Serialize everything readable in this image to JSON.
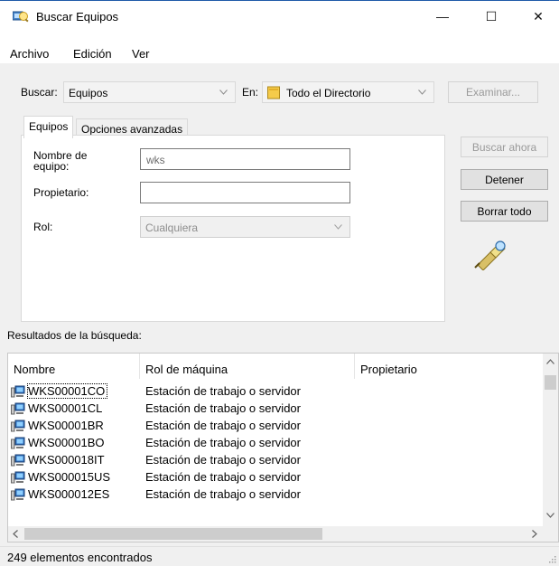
{
  "window": {
    "title": "Buscar Equipos",
    "minimize_glyph": "—",
    "maximize_glyph": "☐",
    "close_glyph": "✕"
  },
  "menu": [
    "Archivo",
    "Edición",
    "Ver"
  ],
  "search": {
    "find_label": "Buscar:",
    "find_value": "Equipos",
    "in_label": "En:",
    "in_value": "Todo el Directorio",
    "browse_label": "Examinar..."
  },
  "tabs": [
    "Equipos",
    "Opciones avanzadas"
  ],
  "form": {
    "name_label": "Nombre de equipo:",
    "name_value": "wks",
    "owner_label": "Propietario:",
    "owner_value": "",
    "role_label": "Rol:",
    "role_value": "Cualquiera"
  },
  "buttons": {
    "find_now": "Buscar ahora",
    "stop": "Detener",
    "clear_all": "Borrar todo"
  },
  "results": {
    "label": "Resultados de la búsqueda:",
    "columns": [
      "Nombre",
      "Rol de máquina",
      "Propietario"
    ],
    "rows": [
      {
        "name": "WKS00001CO",
        "role": "Estación de trabajo o servidor",
        "owner": ""
      },
      {
        "name": "WKS00001CL",
        "role": "Estación de trabajo o servidor",
        "owner": ""
      },
      {
        "name": "WKS00001BR",
        "role": "Estación de trabajo o servidor",
        "owner": ""
      },
      {
        "name": "WKS00001BO",
        "role": "Estación de trabajo o servidor",
        "owner": ""
      },
      {
        "name": "WKS000018IT",
        "role": "Estación de trabajo o servidor",
        "owner": ""
      },
      {
        "name": "WKS000015US",
        "role": "Estación de trabajo o servidor",
        "owner": ""
      },
      {
        "name": "WKS000012ES",
        "role": "Estación de trabajo o servidor",
        "owner": ""
      }
    ]
  },
  "status": "249 elementos encontrados",
  "colors": {
    "accent": "#1f5aa8",
    "window_bg": "#f0f0f0",
    "disabled_text": "#9a9a9a"
  },
  "icons": [
    "search-computers-icon",
    "folder-icon",
    "flashlight-search-icon",
    "computer-icon",
    "chevron-down-icon"
  ]
}
